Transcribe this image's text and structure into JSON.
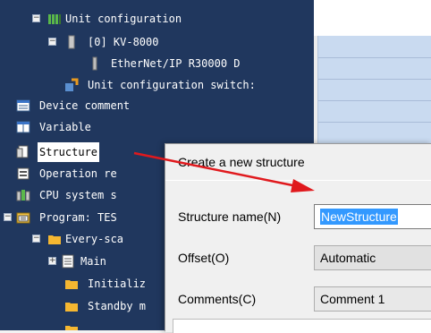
{
  "tree": {
    "items": [
      {
        "label": "Unit configuration",
        "expander": "−",
        "icon": "unit-config-icon"
      },
      {
        "label": "[0]  KV-8000",
        "expander": "−",
        "icon": "cpu-unit-icon"
      },
      {
        "label": "EtherNet/IP   R30000  D",
        "icon": "module-icon"
      },
      {
        "label": "Unit configuration switch:",
        "icon": "switch-icon"
      },
      {
        "label": "Device comment",
        "icon": "device-comment-icon"
      },
      {
        "label": "Variable",
        "icon": "variable-icon"
      },
      {
        "label": "Structure",
        "icon": "structure-icon",
        "selected": true
      },
      {
        "label": "Operation re",
        "icon": "operation-icon"
      },
      {
        "label": "CPU system s",
        "icon": "cpu-system-icon"
      },
      {
        "label": "Program: TES",
        "expander": "−",
        "icon": "program-icon"
      },
      {
        "label": "Every-sca",
        "expander": "−",
        "icon": "folder-icon"
      },
      {
        "label": "Main",
        "expander": "+",
        "icon": "main-program-icon"
      },
      {
        "label": "Initializ",
        "icon": "folder-icon"
      },
      {
        "label": "Standby m",
        "icon": "folder-icon"
      }
    ]
  },
  "dialog": {
    "title": "Create a new structure",
    "name_label": "Structure name(N)",
    "name_value": "NewStructure",
    "offset_label": "Offset(O)",
    "offset_value": "Automatic",
    "comments_label": "Comments(C)",
    "comments_value": "Comment 1"
  },
  "colors": {
    "tree_background": "#20375e",
    "selection_highlight": "#3399ff",
    "arrow": "#e0191d"
  }
}
